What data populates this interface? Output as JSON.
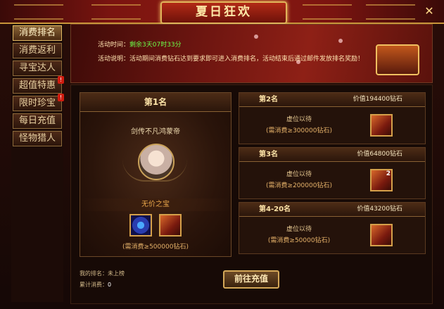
{
  "window": {
    "title": "夏日狂欢",
    "close_symbol": "✕"
  },
  "sidebar": {
    "items": [
      {
        "label": "消费排名",
        "active": true,
        "badge": ""
      },
      {
        "label": "消费返利",
        "active": false,
        "badge": ""
      },
      {
        "label": "寻宝达人",
        "active": false,
        "badge": ""
      },
      {
        "label": "超值特惠",
        "active": false,
        "badge": "!"
      },
      {
        "label": "限时珍宝",
        "active": false,
        "badge": "!"
      },
      {
        "label": "每日充值",
        "active": false,
        "badge": ""
      },
      {
        "label": "怪物猎人",
        "active": false,
        "badge": ""
      }
    ]
  },
  "banner": {
    "time_label": "活动时间：",
    "time_value": "剩余3天07时33分",
    "desc": "活动说明：活动期间消费钻石达到要求即可进入消费排名，活动结束后通过邮件发放排名奖励！"
  },
  "rank1": {
    "rank_label": "第1名",
    "player_name": "剑传不凡鸿蒙帝",
    "reward_title": "无价之宝",
    "requirement": "(需消费≥500000钻石)"
  },
  "ranks": [
    {
      "rank_label": "第2名",
      "value": "价值194400钻石",
      "vacant": "虚位以待",
      "requirement": "(需消费≥300000钻石)",
      "item_count": ""
    },
    {
      "rank_label": "第3名",
      "value": "价值64800钻石",
      "vacant": "虚位以待",
      "requirement": "(需消费≥200000钻石)",
      "item_count": "2"
    },
    {
      "rank_label": "第4-20名",
      "value": "价值43200钻石",
      "vacant": "虚位以待",
      "requirement": "(需消费≥50000钻石)",
      "item_count": ""
    }
  ],
  "footer": {
    "my_rank_label": "我的排名：",
    "my_rank_value": "未上榜",
    "total_label": "累计消费：",
    "total_value": "0",
    "charge_button": "前往充值"
  },
  "colors": {
    "accent_gold": "#e0b45a",
    "time_green": "#6cff4a",
    "title_red": "#b22a16"
  }
}
